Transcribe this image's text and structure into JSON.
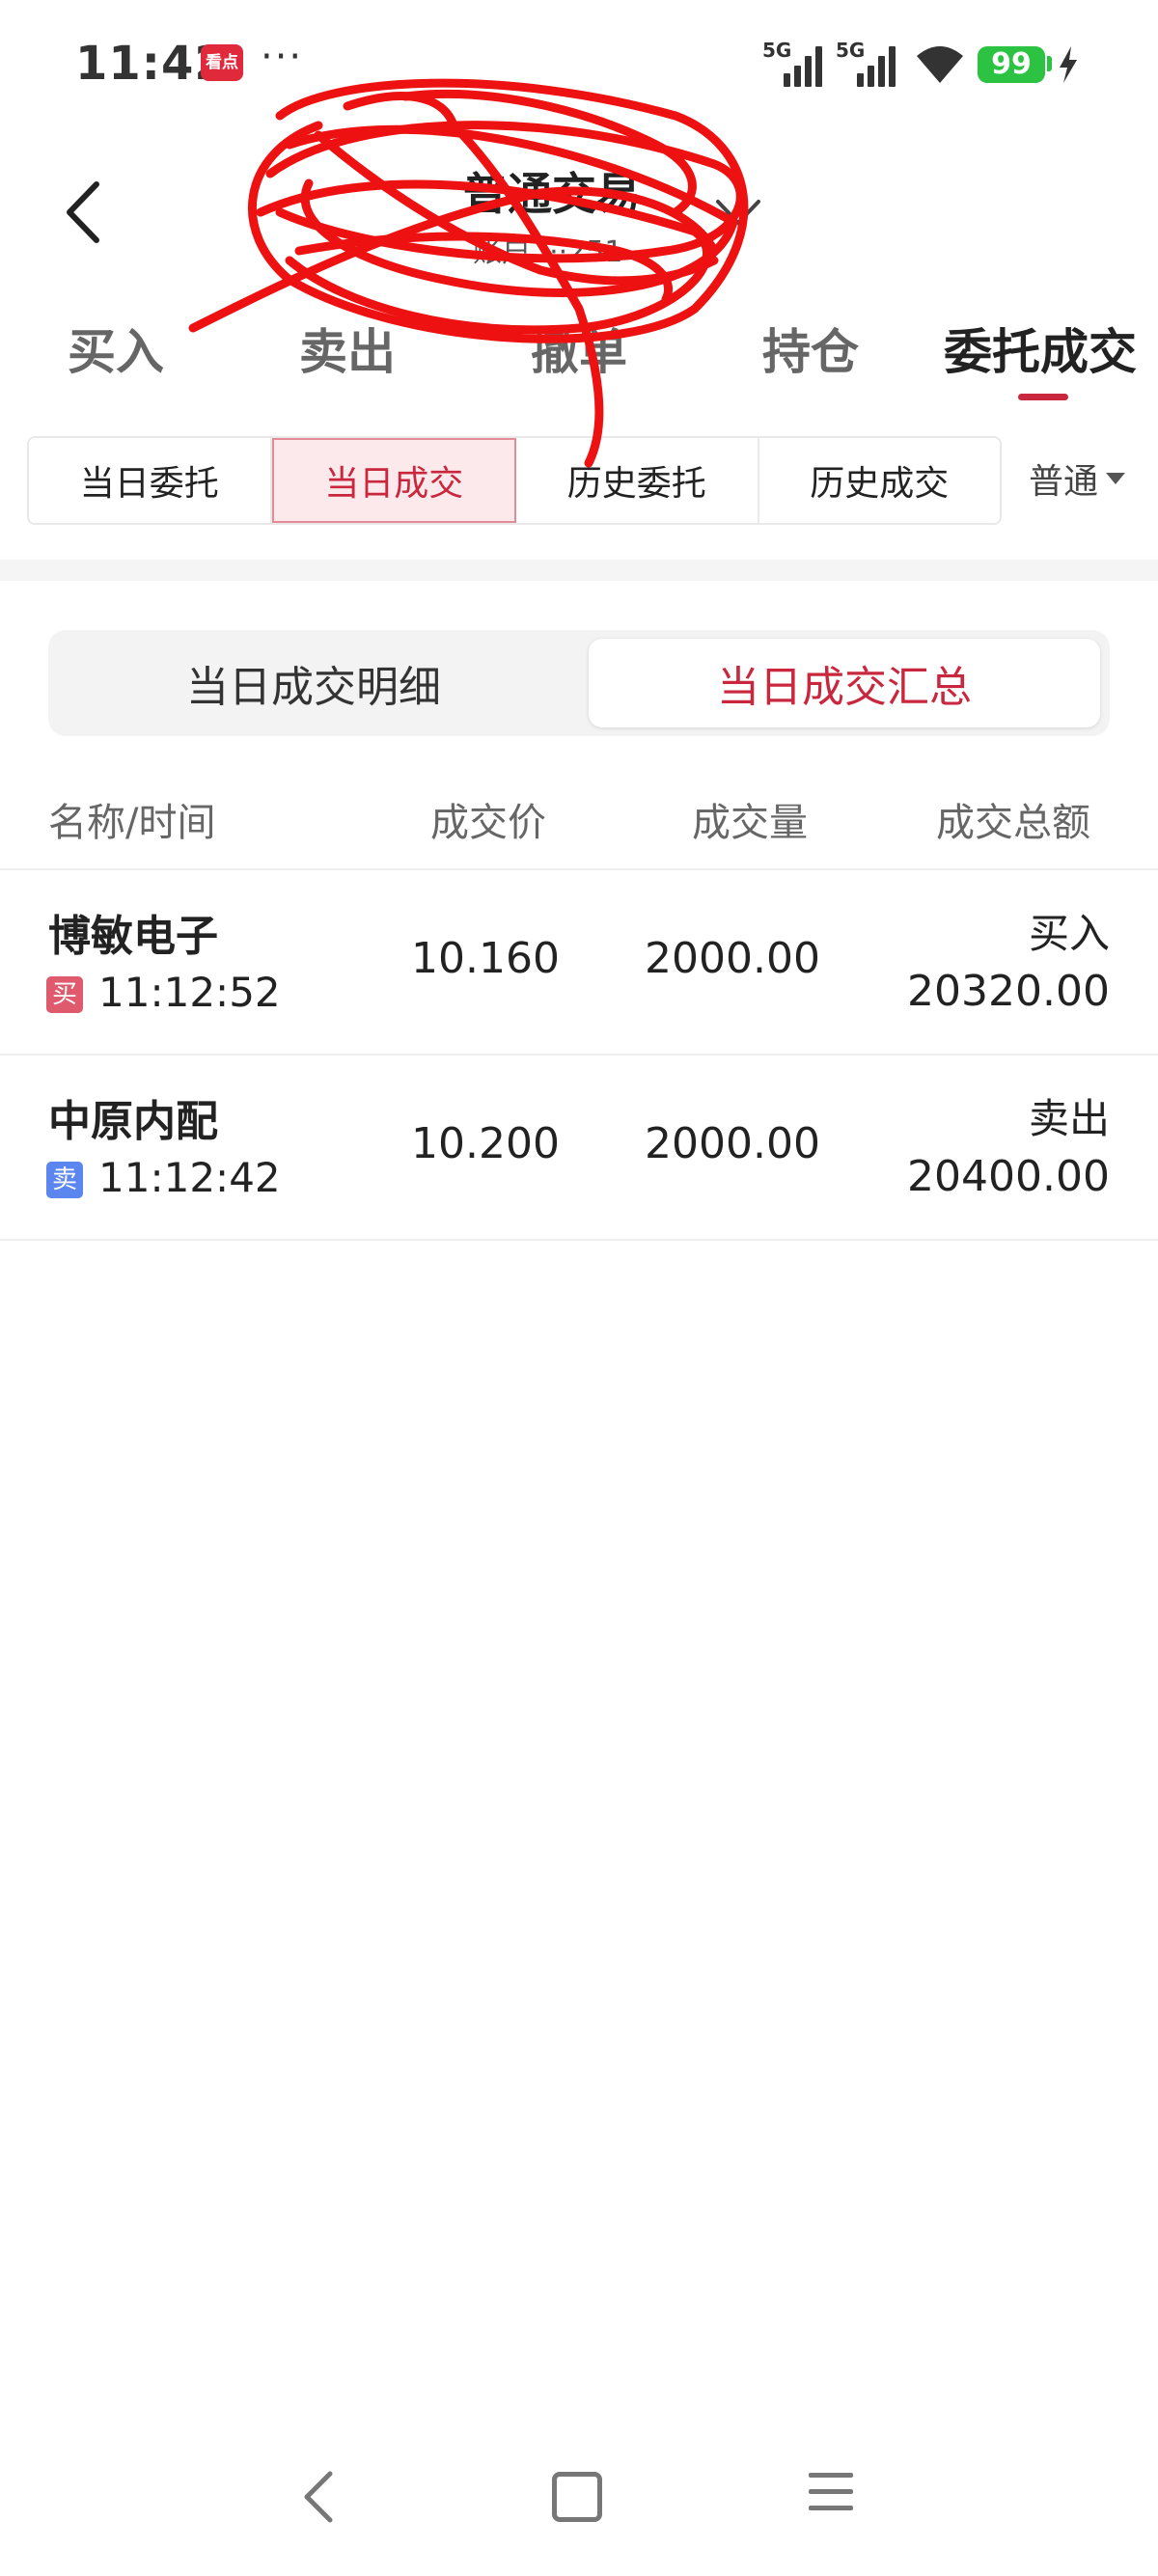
{
  "status_bar": {
    "time": "11:42",
    "app_badge": "看点",
    "more": "···",
    "network_1": "5G",
    "network_2": "5G",
    "battery": "99"
  },
  "header": {
    "title": "普通交易",
    "subtitle": "账户 ···251"
  },
  "main_tabs": [
    "买入",
    "卖出",
    "撤单",
    "持仓",
    "委托成交"
  ],
  "sub_tabs": [
    "当日委托",
    "当日成交",
    "历史委托",
    "历史成交"
  ],
  "mode_select": "普通",
  "segment": {
    "left": "当日成交明细",
    "right": "当日成交汇总"
  },
  "table": {
    "headers": [
      "名称/时间",
      "成交价",
      "成交量",
      "成交总额"
    ],
    "rows": [
      {
        "name": "博敏电子",
        "tag": "买",
        "time": "11:12:52",
        "price": "10.160",
        "qty": "2000.00",
        "direction": "买入",
        "amount": "20320.00"
      },
      {
        "name": "中原内配",
        "tag": "卖",
        "time": "11:12:42",
        "price": "10.200",
        "qty": "2000.00",
        "direction": "卖出",
        "amount": "20400.00"
      }
    ]
  },
  "colors": {
    "accent": "#c8273d",
    "buy_tag": "#e05a6e",
    "sell_tag": "#5b86f0",
    "scribble": "#ee1111"
  }
}
